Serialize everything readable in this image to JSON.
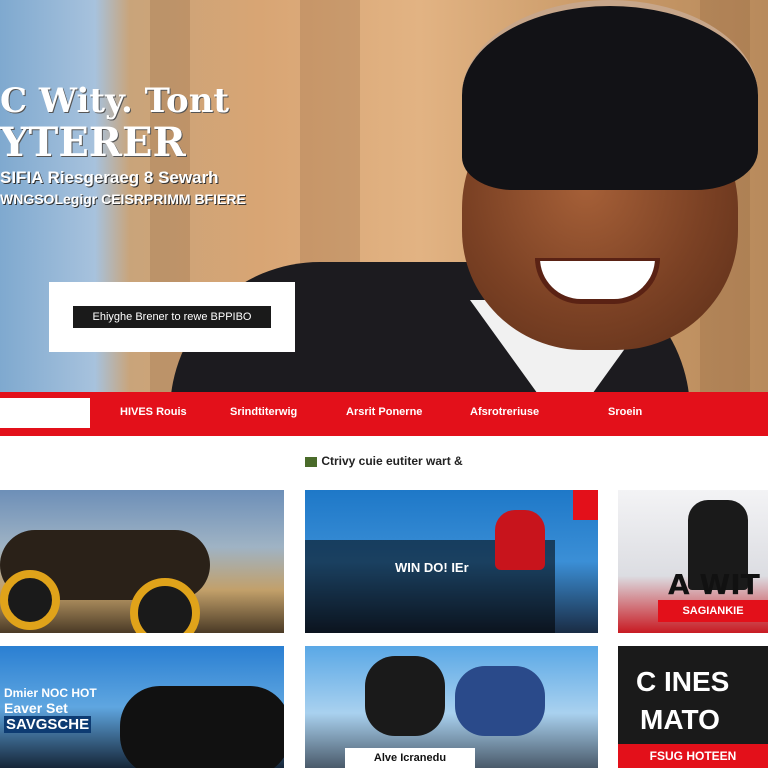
{
  "hero": {
    "title_line1": "C Wity. Tont",
    "title_line2": "YTERER",
    "subtitle_line1": "SIFIA Riesgeraeg 8 Sewarh",
    "subtitle_line2": "WNGSOLegigr CEISRPRIMM BFIERE",
    "cta_label": "Ehiyghe Brener to rewe BPPIBO"
  },
  "nav": {
    "items": [
      "HIVES Rouis",
      "Srindtiterwig",
      "Arsrit Ponerne",
      "Afsrotreriuse",
      "Sroein"
    ]
  },
  "section": {
    "heading": "Ctrivy cuie eutiter wart &"
  },
  "cards": {
    "c2_caption": "WIN DO! IEr",
    "c3_title": "A WIT",
    "c3_banner": "SAGIANKIE",
    "c4_line1": "Dmier NOC HOT",
    "c4_line2": "Eaver Set",
    "c4_line3": "SAVGSCHE",
    "c5_caption": "Alve Icranedu",
    "c6_line1": "C INES",
    "c6_line2": "MATO",
    "c6_banner": "FSUG HOTEEN"
  },
  "colors": {
    "accent_red": "#e3101a",
    "dark": "#1a1a1a"
  }
}
